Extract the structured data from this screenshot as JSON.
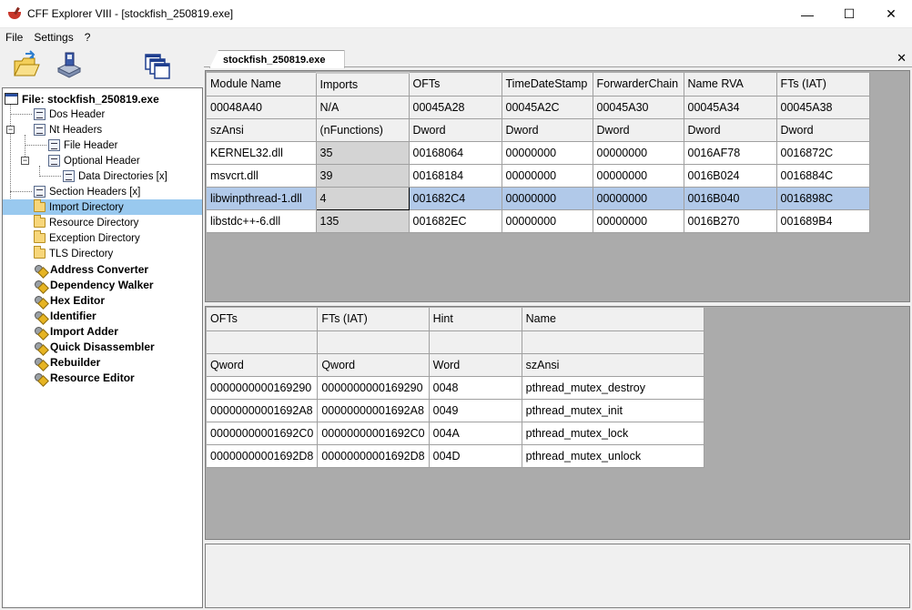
{
  "window": {
    "title": "CFF Explorer VIII - [stockfish_250819.exe]",
    "controls": [
      "—",
      "☐",
      "✕"
    ]
  },
  "menu": [
    "File",
    "Settings",
    "?"
  ],
  "tab": {
    "label": "stockfish_250819.exe",
    "close": "✕"
  },
  "tree": {
    "root": "File: stockfish_250819.exe",
    "dos_header": "Dos Header",
    "nt_headers": "Nt Headers",
    "file_header": "File Header",
    "optional_header": "Optional Header",
    "data_directories": "Data Directories [x]",
    "section_headers": "Section Headers [x]",
    "import_directory": "Import Directory",
    "resource_directory": "Resource Directory",
    "exception_directory": "Exception Directory",
    "tls_directory": "TLS Directory",
    "tools": [
      "Address Converter",
      "Dependency Walker",
      "Hex Editor",
      "Identifier",
      "Import Adder",
      "Quick Disassembler",
      "Rebuilder",
      "Resource Editor"
    ]
  },
  "imports_table": {
    "columns": [
      "Module Name",
      "Imports",
      "OFTs",
      "TimeDateStamp",
      "ForwarderChain",
      "Name RVA",
      "FTs (IAT)"
    ],
    "offsets": [
      "00048A40",
      "N/A",
      "00045A28",
      "00045A2C",
      "00045A30",
      "00045A34",
      "00045A38"
    ],
    "types": [
      "szAnsi",
      "(nFunctions)",
      "Dword",
      "Dword",
      "Dword",
      "Dword",
      "Dword"
    ],
    "rows": [
      [
        "KERNEL32.dll",
        "35",
        "00168064",
        "00000000",
        "00000000",
        "0016AF78",
        "0016872C"
      ],
      [
        "msvcrt.dll",
        "39",
        "00168184",
        "00000000",
        "00000000",
        "0016B024",
        "0016884C"
      ],
      [
        "libwinpthread-1.dll",
        "4",
        "001682C4",
        "00000000",
        "00000000",
        "0016B040",
        "0016898C"
      ],
      [
        "libstdc++-6.dll",
        "135",
        "001682EC",
        "00000000",
        "00000000",
        "0016B270",
        "001689B4"
      ]
    ]
  },
  "functions_table": {
    "columns": [
      "OFTs",
      "FTs (IAT)",
      "Hint",
      "Name"
    ],
    "offsets": [
      "",
      "",
      "",
      ""
    ],
    "types": [
      "Qword",
      "Qword",
      "Word",
      "szAnsi"
    ],
    "rows": [
      [
        "0000000000169290",
        "0000000000169290",
        "0048",
        "pthread_mutex_destroy"
      ],
      [
        "00000000001692A8",
        "00000000001692A8",
        "0049",
        "pthread_mutex_init"
      ],
      [
        "00000000001692C0",
        "00000000001692C0",
        "004A",
        "pthread_mutex_lock"
      ],
      [
        "00000000001692D8",
        "00000000001692D8",
        "004D",
        "pthread_mutex_unlock"
      ]
    ]
  }
}
